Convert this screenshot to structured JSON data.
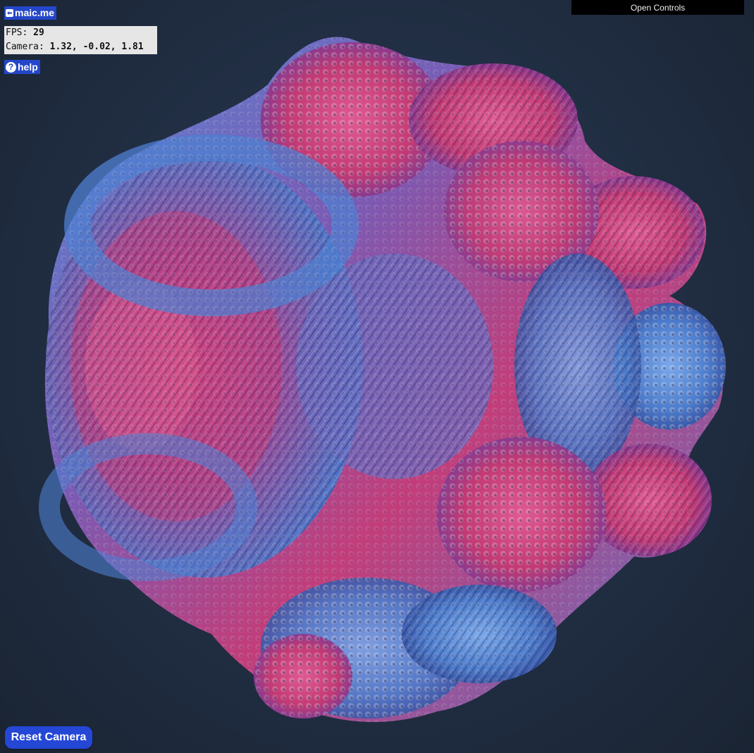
{
  "brand": {
    "label": "maic.me",
    "icon": "back-arrow-icon"
  },
  "stats": {
    "fps_label": "FPS: ",
    "fps_value": "29",
    "camera_label": "Camera: ",
    "camera_value": "1.32, -0.02, 1.81"
  },
  "help": {
    "label": "help",
    "icon": "question-circle-icon",
    "icon_glyph": "?"
  },
  "controls": {
    "label": "Open Controls"
  },
  "reset": {
    "label": "Reset Camera"
  },
  "colors": {
    "accent": "#2447c9",
    "pink": "#c93a78",
    "blue": "#4a78c8",
    "background": "#1f2a3a"
  }
}
